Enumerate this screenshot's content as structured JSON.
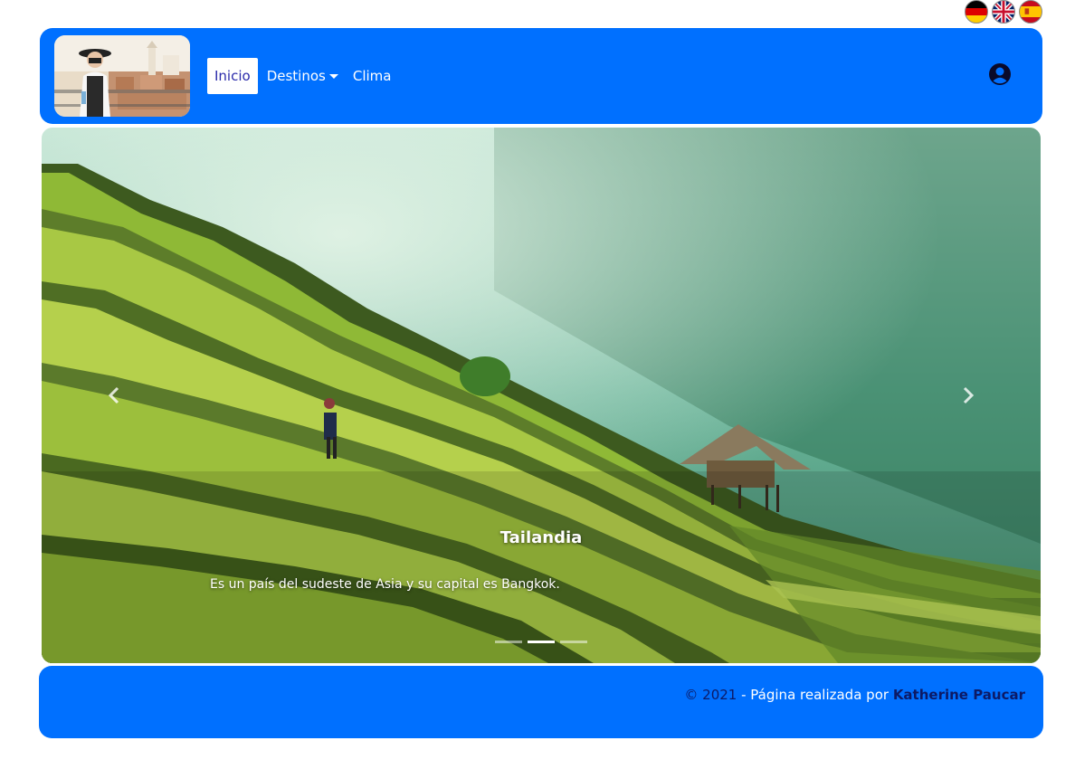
{
  "languages": [
    "de",
    "en",
    "es"
  ],
  "colors": {
    "primary": "#0070ff",
    "active_text": "#2a2aaa",
    "footer_dark": "#0c1a66"
  },
  "navbar": {
    "items": [
      {
        "label": "Inicio",
        "active": true
      },
      {
        "label": "Destinos",
        "dropdown": true
      },
      {
        "label": "Clima"
      }
    ],
    "user_icon": "user-circle-icon"
  },
  "carousel": {
    "active_index": 1,
    "slide_count": 3,
    "caption": {
      "title": "Tailandia",
      "text": "Es un país del sudeste de Asia y su capital es Bangkok."
    }
  },
  "footer": {
    "year": "© 2021",
    "text": " - Página realizada por ",
    "author": "Katherine Paucar"
  }
}
